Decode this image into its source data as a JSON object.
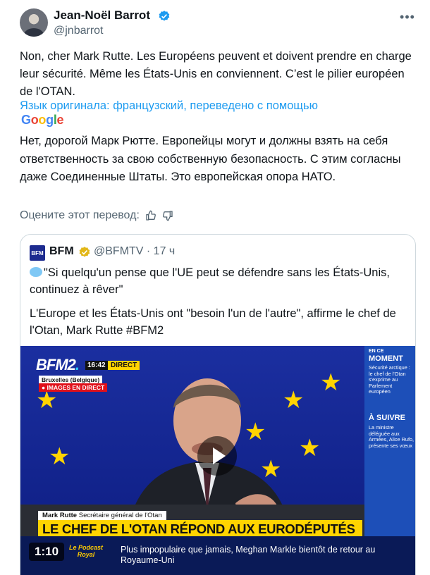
{
  "author": {
    "name": "Jean-Noël Barrot",
    "handle": "@jnbarrot"
  },
  "tweet": {
    "text": "Non, cher Mark Rutte. Les Européens peuvent et doivent prendre en charge leur sécurité. Même les États-Unis en conviennent. C’est le pilier européen de l'OTAN.",
    "translated_label": "Язык оригинала: французский, переведено с помощью",
    "google_letters": [
      "G",
      "o",
      "o",
      "g",
      "l",
      "e"
    ],
    "translation": "Нет, дорогой Марк Рютте. Европейцы могут и должны взять на себя ответственность за свою собственную безопасность. С этим согласны даже Соединенные Штаты. Это европейская опора НАТО.",
    "rate_label": "Оцените этот перевод:"
  },
  "quote": {
    "logo_text": "BFM",
    "name": "BFM",
    "handle_time": "@BFMTV · 17 ч",
    "text1": "\"Si quelqu'un pense que l'UE peut se défendre sans les États-Unis, continuez à rêver\"",
    "text2": "L'Europe et les États-Unis ont \"besoin l'un de l'autre\", affirme le chef de l'Otan, Mark Rutte #BFM2"
  },
  "video": {
    "channel": "BFM2",
    "time": "16:42",
    "direct": "DIRECT",
    "location": "Bruxelles (Belgique)",
    "live": "● IMAGES EN DIRECT",
    "sidebar_small": "EN CE",
    "sidebar_title": "MOMENT",
    "sidebar_text1": "Sécurité arctique : le chef de l'Otan s'exprime au Parlement européen",
    "sidebar_title2": "À SUIVRE",
    "sidebar_text2": "La ministre déléguée aux Armées, Alice Rufo, présente ses vœux",
    "caption_name": "Mark Rutte",
    "caption_role": "Secrétaire général de l'Otan",
    "headline": "LE CHEF DE L'OTAN RÉPOND AUX EURODÉPUTÉS",
    "ticker_logo": "Le Podcast Royal",
    "ticker_text": "Plus impopulaire que jamais, Meghan Markle bientôt de retour au Royaume-Uni",
    "duration": "1:10"
  },
  "colors": {
    "link": "#1d9bf0",
    "verified": "#1d9bf0",
    "gold_badge": "#e2b719",
    "direct_yellow": "#ffd400"
  },
  "icons": [
    "verified-badge-icon",
    "more-icon",
    "thumbs-up-icon",
    "thumbs-down-icon",
    "gold-verified-badge-icon",
    "play-icon",
    "speech-bubble-icon"
  ]
}
